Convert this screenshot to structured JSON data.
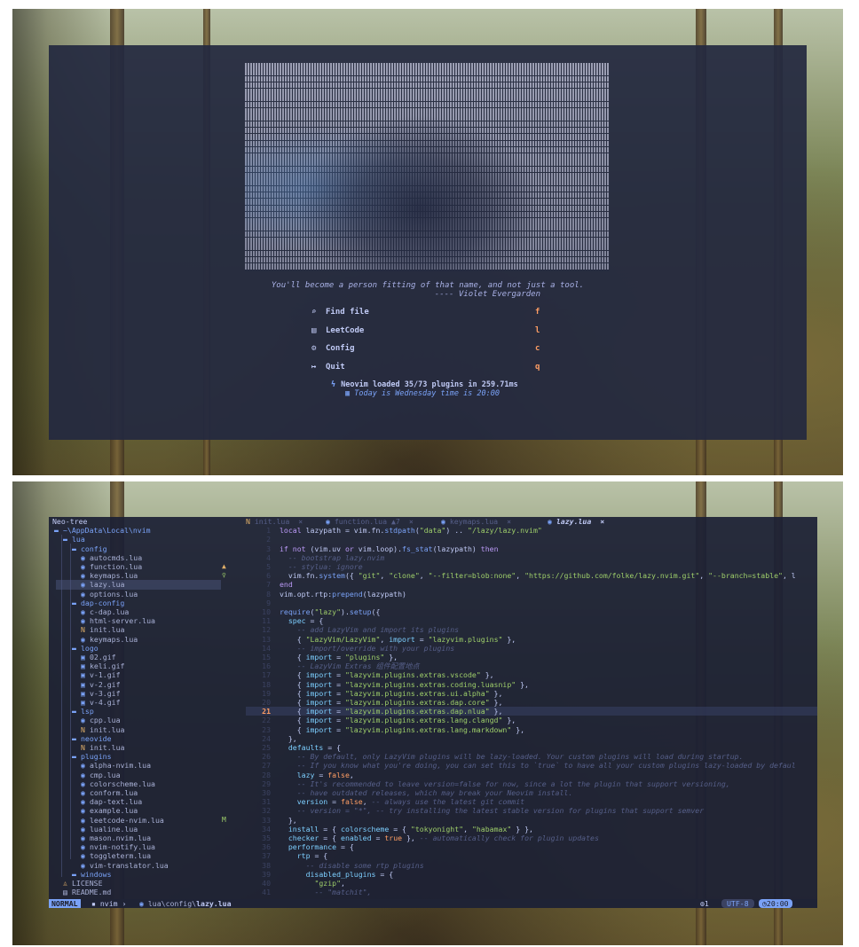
{
  "dashboard": {
    "quote_line1": "You'll become a person fitting of that name, and not just a tool.",
    "quote_line2": "---- Violet Evergarden",
    "menu": [
      {
        "icon": "search-icon",
        "glyph": "⌕",
        "label": "Find file",
        "key": "f"
      },
      {
        "icon": "leetcode-icon",
        "glyph": "▤",
        "label": "LeetCode",
        "key": "l"
      },
      {
        "icon": "gear-icon",
        "glyph": "⚙",
        "label": "Config",
        "key": "c"
      },
      {
        "icon": "quit-icon",
        "glyph": "↦",
        "label": "Quit",
        "key": "q"
      }
    ],
    "footer_loaded": "Neovim loaded 35/73 plugins in 259.71ms",
    "footer_date": "Today is Wednesday  time is 20:00"
  },
  "editor": {
    "tree_title": "Neo-tree",
    "tree": [
      {
        "depth": 0,
        "type": "dir",
        "name": "~\\AppData\\Local\\nvim"
      },
      {
        "depth": 1,
        "type": "dir",
        "name": "lua"
      },
      {
        "depth": 2,
        "type": "dir",
        "name": "config"
      },
      {
        "depth": 3,
        "type": "file",
        "name": "autocmds.lua"
      },
      {
        "depth": 3,
        "type": "file",
        "name": "function.lua",
        "diag": "▲",
        "diag_color": "#e0af68"
      },
      {
        "depth": 3,
        "type": "file",
        "name": "keymaps.lua",
        "diag": "♀",
        "diag_color": "#9ece6a"
      },
      {
        "depth": 3,
        "type": "file",
        "name": "lazy.lua",
        "selected": true
      },
      {
        "depth": 3,
        "type": "file",
        "name": "options.lua"
      },
      {
        "depth": 2,
        "type": "dir",
        "name": "dap-config"
      },
      {
        "depth": 3,
        "type": "file",
        "name": "c-dap.lua"
      },
      {
        "depth": 3,
        "type": "file",
        "name": "html-server.lua"
      },
      {
        "depth": 3,
        "type": "file",
        "name": "init.lua"
      },
      {
        "depth": 3,
        "type": "file",
        "name": "keymaps.lua"
      },
      {
        "depth": 2,
        "type": "dir",
        "name": "logo"
      },
      {
        "depth": 3,
        "type": "file",
        "name": "02.gif"
      },
      {
        "depth": 3,
        "type": "file",
        "name": "keli.gif"
      },
      {
        "depth": 3,
        "type": "file",
        "name": "v-1.gif"
      },
      {
        "depth": 3,
        "type": "file",
        "name": "v-2.gif"
      },
      {
        "depth": 3,
        "type": "file",
        "name": "v-3.gif"
      },
      {
        "depth": 3,
        "type": "file",
        "name": "v-4.gif"
      },
      {
        "depth": 2,
        "type": "dir",
        "name": "lsp"
      },
      {
        "depth": 3,
        "type": "file",
        "name": "cpp.lua"
      },
      {
        "depth": 3,
        "type": "file",
        "name": "init.lua"
      },
      {
        "depth": 2,
        "type": "dir",
        "name": "neovide"
      },
      {
        "depth": 3,
        "type": "file",
        "name": "init.lua"
      },
      {
        "depth": 2,
        "type": "dir",
        "name": "plugins"
      },
      {
        "depth": 3,
        "type": "file",
        "name": "alpha-nvim.lua"
      },
      {
        "depth": 3,
        "type": "file",
        "name": "cmp.lua"
      },
      {
        "depth": 3,
        "type": "file",
        "name": "colorscheme.lua"
      },
      {
        "depth": 3,
        "type": "file",
        "name": "conform.lua"
      },
      {
        "depth": 3,
        "type": "file",
        "name": "dap-text.lua"
      },
      {
        "depth": 3,
        "type": "file",
        "name": "example.lua"
      },
      {
        "depth": 3,
        "type": "file",
        "name": "leetcode-nvim.lua",
        "diag": "M",
        "diag_color": "#9ece6a"
      },
      {
        "depth": 3,
        "type": "file",
        "name": "lualine.lua"
      },
      {
        "depth": 3,
        "type": "file",
        "name": "mason.nvim.lua"
      },
      {
        "depth": 3,
        "type": "file",
        "name": "nvim-notify.lua"
      },
      {
        "depth": 3,
        "type": "file",
        "name": "toggleterm.lua"
      },
      {
        "depth": 3,
        "type": "file",
        "name": "vim-translator.lua"
      },
      {
        "depth": 2,
        "type": "dir",
        "name": "windows"
      },
      {
        "depth": 1,
        "type": "file",
        "name": "LICENSE"
      },
      {
        "depth": 1,
        "type": "file",
        "name": "README.md"
      }
    ],
    "tabs": [
      {
        "label": "init.lua",
        "close": "×",
        "active": false
      },
      {
        "label": "function.lua ▲7",
        "close": "×",
        "active": false
      },
      {
        "label": "keymaps.lua",
        "close": "×",
        "active": false
      },
      {
        "label": "lazy.lua",
        "close": "×",
        "active": true
      }
    ],
    "current_line": 21,
    "code": [
      "<span class=\"kw\">local</span> lazypath = vim.fn.<span class=\"fn\">stdpath</span>(<span class=\"st\">\"data\"</span>) .. <span class=\"st\">\"/lazy/lazy.nvim\"</span>",
      "",
      "<span class=\"kw\">if not</span> (vim.uv <span class=\"kw\">or</span> vim.loop).<span class=\"fn\">fs_stat</span>(lazypath) <span class=\"kw\">then</span>",
      "  <span class=\"cm\">-- bootstrap lazy.nvim</span>",
      "  <span class=\"cm\">-- stylua: ignore</span>",
      "  vim.fn.<span class=\"fn\">system</span>({ <span class=\"st\">\"git\"</span>, <span class=\"st\">\"clone\"</span>, <span class=\"st\">\"--filter=blob:none\"</span>, <span class=\"st\">\"https://github.com/folke/lazy.nvim.git\"</span>, <span class=\"st\">\"--branch=stable\"</span>, l",
      "<span class=\"kw\">end</span>",
      "vim.opt.rtp:<span class=\"fn\">prepend</span>(lazypath)",
      "",
      "<span class=\"fn\">require</span>(<span class=\"st\">\"lazy\"</span>).<span class=\"fn\">setup</span>({",
      "  <span class=\"pr\">spec</span> = {",
      "    <span class=\"cm\">-- add LazyVim and import its plugins</span>",
      "    { <span class=\"st\">\"LazyVim/LazyVim\"</span>, <span class=\"pr\">import</span> = <span class=\"st\">\"lazyvim.plugins\"</span> },",
      "    <span class=\"cm\">-- import/override with your plugins</span>",
      "    { <span class=\"pr\">import</span> = <span class=\"st\">\"plugins\"</span> },",
      "    <span class=\"cm\">-- LazyVim Extras 组件配置地点</span>",
      "    { <span class=\"pr\">import</span> = <span class=\"st\">\"lazyvim.plugins.extras.vscode\"</span> },",
      "    { <span class=\"pr\">import</span> = <span class=\"st\">\"lazyvim.plugins.extras.coding.luasnip\"</span> },",
      "    { <span class=\"pr\">import</span> = <span class=\"st\">\"lazyvim.plugins.extras.ui.alpha\"</span> },",
      "    { <span class=\"pr\">import</span> = <span class=\"st\">\"lazyvim.plugins.extras.dap.core\"</span> },",
      "    { <span class=\"pr\">import</span> = <span class=\"st\">\"lazyvim.plugins.extras.dap.nlua\"</span> },",
      "    { <span class=\"pr\">import</span> = <span class=\"st\">\"lazyvim.plugins.extras.lang.clangd\"</span> },",
      "    { <span class=\"pr\">import</span> = <span class=\"st\">\"lazyvim.plugins.extras.lang.markdown\"</span> },",
      "  },",
      "  <span class=\"pr\">defaults</span> = {",
      "    <span class=\"cm\">-- By default, only LazyVim plugins will be lazy-loaded. Your custom plugins will load during startup.</span>",
      "    <span class=\"cm\">-- If you know what you're doing, you can set this to `true` to have all your custom plugins lazy-loaded by defaul</span>",
      "    <span class=\"pr\">lazy</span> = <span class=\"bl\">false</span>,",
      "    <span class=\"cm\">-- It's recommended to leave version=false for now, since a lot the plugin that support versioning,</span>",
      "    <span class=\"cm\">-- have outdated releases, which may break your Neovim install.</span>",
      "    <span class=\"pr\">version</span> = <span class=\"bl\">false</span>, <span class=\"cm\">-- always use the latest git commit</span>",
      "    <span class=\"cm\">-- version = \"*\", -- try installing the latest stable version for plugins that support semver</span>",
      "  },",
      "  <span class=\"pr\">install</span> = { <span class=\"pr\">colorscheme</span> = { <span class=\"st\">\"tokyonight\"</span>, <span class=\"st\">\"habamax\"</span> } },",
      "  <span class=\"pr\">checker</span> = { <span class=\"pr\">enabled</span> = <span class=\"bl\">true</span> }, <span class=\"cm\">-- automatically check for plugin updates</span>",
      "  <span class=\"pr\">performance</span> = {",
      "    <span class=\"pr\">rtp</span> = {",
      "      <span class=\"cm\">-- disable some rtp plugins</span>",
      "      <span class=\"pr\">disabled_plugins</span> = {",
      "        <span class=\"st\">\"gzip\"</span>,",
      "        <span class=\"cm\">-- \"matchit\",</span>"
    ],
    "status": {
      "mode": "NORMAL",
      "branch": "nvim",
      "path_prefix": "lua\\config\\",
      "path_file": "lazy.lua",
      "diagnostics": "⚙1",
      "encoding": "UTF-8",
      "time": "◷20:00"
    }
  }
}
